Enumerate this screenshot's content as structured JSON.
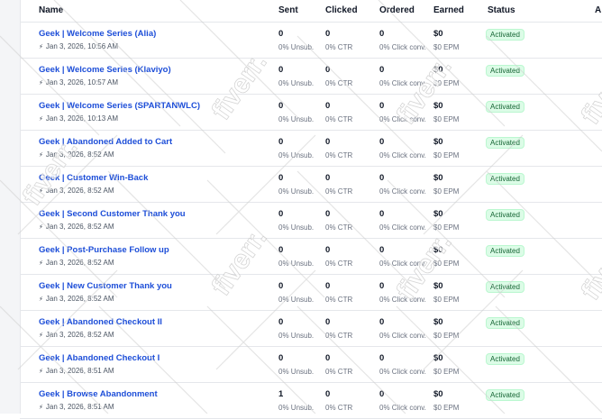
{
  "columns": {
    "name": "Name",
    "sent": "Sent",
    "clicked": "Clicked",
    "ordered": "Ordered",
    "earned": "Earned",
    "status": "Status",
    "actions": "A"
  },
  "status_color": "#166534",
  "status_bg": "#dcfce7",
  "link_color": "#1d4ed8",
  "rows": [
    {
      "name": "Geek | Welcome Series (Alia)",
      "date": "Jan 3, 2026, 10:56 AM",
      "sent": "0",
      "unsub": "0% Unsub.",
      "clicked": "0",
      "ctr": "0% CTR",
      "ordered": "0",
      "conv": "0% Click conv.",
      "earned": "$0",
      "epm": "$0 EPM",
      "status": "Activated"
    },
    {
      "name": "Geek | Welcome Series (Klaviyo)",
      "date": "Jan 3, 2026, 10:57 AM",
      "sent": "0",
      "unsub": "0% Unsub.",
      "clicked": "0",
      "ctr": "0% CTR",
      "ordered": "0",
      "conv": "0% Click conv.",
      "earned": "$0",
      "epm": "$0 EPM",
      "status": "Activated"
    },
    {
      "name": "Geek | Welcome Series (SPARTANWLC)",
      "date": "Jan 3, 2026, 10:13 AM",
      "sent": "0",
      "unsub": "0% Unsub.",
      "clicked": "0",
      "ctr": "0% CTR",
      "ordered": "0",
      "conv": "0% Click conv.",
      "earned": "$0",
      "epm": "$0 EPM",
      "status": "Activated"
    },
    {
      "name": "Geek | Abandoned Added to Cart",
      "date": "Jan 3, 2026, 8:52 AM",
      "sent": "0",
      "unsub": "0% Unsub.",
      "clicked": "0",
      "ctr": "0% CTR",
      "ordered": "0",
      "conv": "0% Click conv.",
      "earned": "$0",
      "epm": "$0 EPM",
      "status": "Activated"
    },
    {
      "name": "Geek | Customer Win-Back",
      "date": "Jan 3, 2026, 8:52 AM",
      "sent": "0",
      "unsub": "0% Unsub.",
      "clicked": "0",
      "ctr": "0% CTR",
      "ordered": "0",
      "conv": "0% Click conv.",
      "earned": "$0",
      "epm": "$0 EPM",
      "status": "Activated"
    },
    {
      "name": "Geek | Second Customer Thank you",
      "date": "Jan 3, 2026, 8:52 AM",
      "sent": "0",
      "unsub": "0% Unsub.",
      "clicked": "0",
      "ctr": "0% CTR",
      "ordered": "0",
      "conv": "0% Click conv.",
      "earned": "$0",
      "epm": "$0 EPM",
      "status": "Activated"
    },
    {
      "name": "Geek | Post-Purchase Follow up",
      "date": "Jan 3, 2026, 8:52 AM",
      "sent": "0",
      "unsub": "0% Unsub.",
      "clicked": "0",
      "ctr": "0% CTR",
      "ordered": "0",
      "conv": "0% Click conv.",
      "earned": "$0",
      "epm": "$0 EPM",
      "status": "Activated"
    },
    {
      "name": "Geek | New Customer Thank you",
      "date": "Jan 3, 2026, 8:52 AM",
      "sent": "0",
      "unsub": "0% Unsub.",
      "clicked": "0",
      "ctr": "0% CTR",
      "ordered": "0",
      "conv": "0% Click conv.",
      "earned": "$0",
      "epm": "$0 EPM",
      "status": "Activated"
    },
    {
      "name": "Geek | Abandoned Checkout II",
      "date": "Jan 3, 2026, 8:52 AM",
      "sent": "0",
      "unsub": "0% Unsub.",
      "clicked": "0",
      "ctr": "0% CTR",
      "ordered": "0",
      "conv": "0% Click conv.",
      "earned": "$0",
      "epm": "$0 EPM",
      "status": "Activated"
    },
    {
      "name": "Geek | Abandoned Checkout I",
      "date": "Jan 3, 2026, 8:51 AM",
      "sent": "0",
      "unsub": "0% Unsub.",
      "clicked": "0",
      "ctr": "0% CTR",
      "ordered": "0",
      "conv": "0% Click conv.",
      "earned": "$0",
      "epm": "$0 EPM",
      "status": "Activated"
    },
    {
      "name": "Geek | Browse Abandonment",
      "date": "Jan 3, 2026, 8:51 AM",
      "sent": "1",
      "unsub": "0% Unsub.",
      "clicked": "0",
      "ctr": "0% CTR",
      "ordered": "0",
      "conv": "0% Click conv.",
      "earned": "$0",
      "epm": "$0 EPM",
      "status": "Activated"
    }
  ],
  "watermark": {
    "text": "fiverr.",
    "icon": "fiverr-watermark-logo"
  }
}
